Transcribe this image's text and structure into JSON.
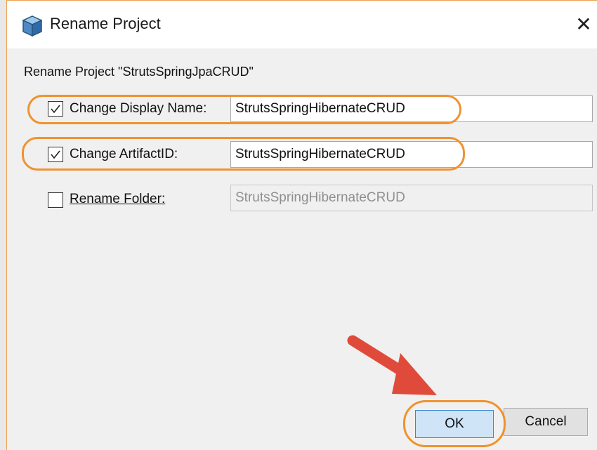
{
  "window": {
    "title": "Rename Project",
    "close_glyph": "✕",
    "icon": "project-cube-icon"
  },
  "heading": "Rename Project \"StrutsSpringJpaCRUD\"",
  "options": [
    {
      "label": "Change Display Name:",
      "checked": true,
      "value": "StrutsSpringHibernateCRUD",
      "enabled": true
    },
    {
      "label": "Change ArtifactID:",
      "checked": true,
      "value": "StrutsSpringHibernateCRUD",
      "enabled": true
    },
    {
      "label": "Rename Folder:",
      "checked": false,
      "value": "StrutsSpringHibernateCRUD",
      "enabled": false
    }
  ],
  "buttons": {
    "ok": "OK",
    "cancel": "Cancel"
  },
  "annotations": {
    "highlight_color": "#f0922f",
    "arrow_color": "#e04a3a"
  }
}
